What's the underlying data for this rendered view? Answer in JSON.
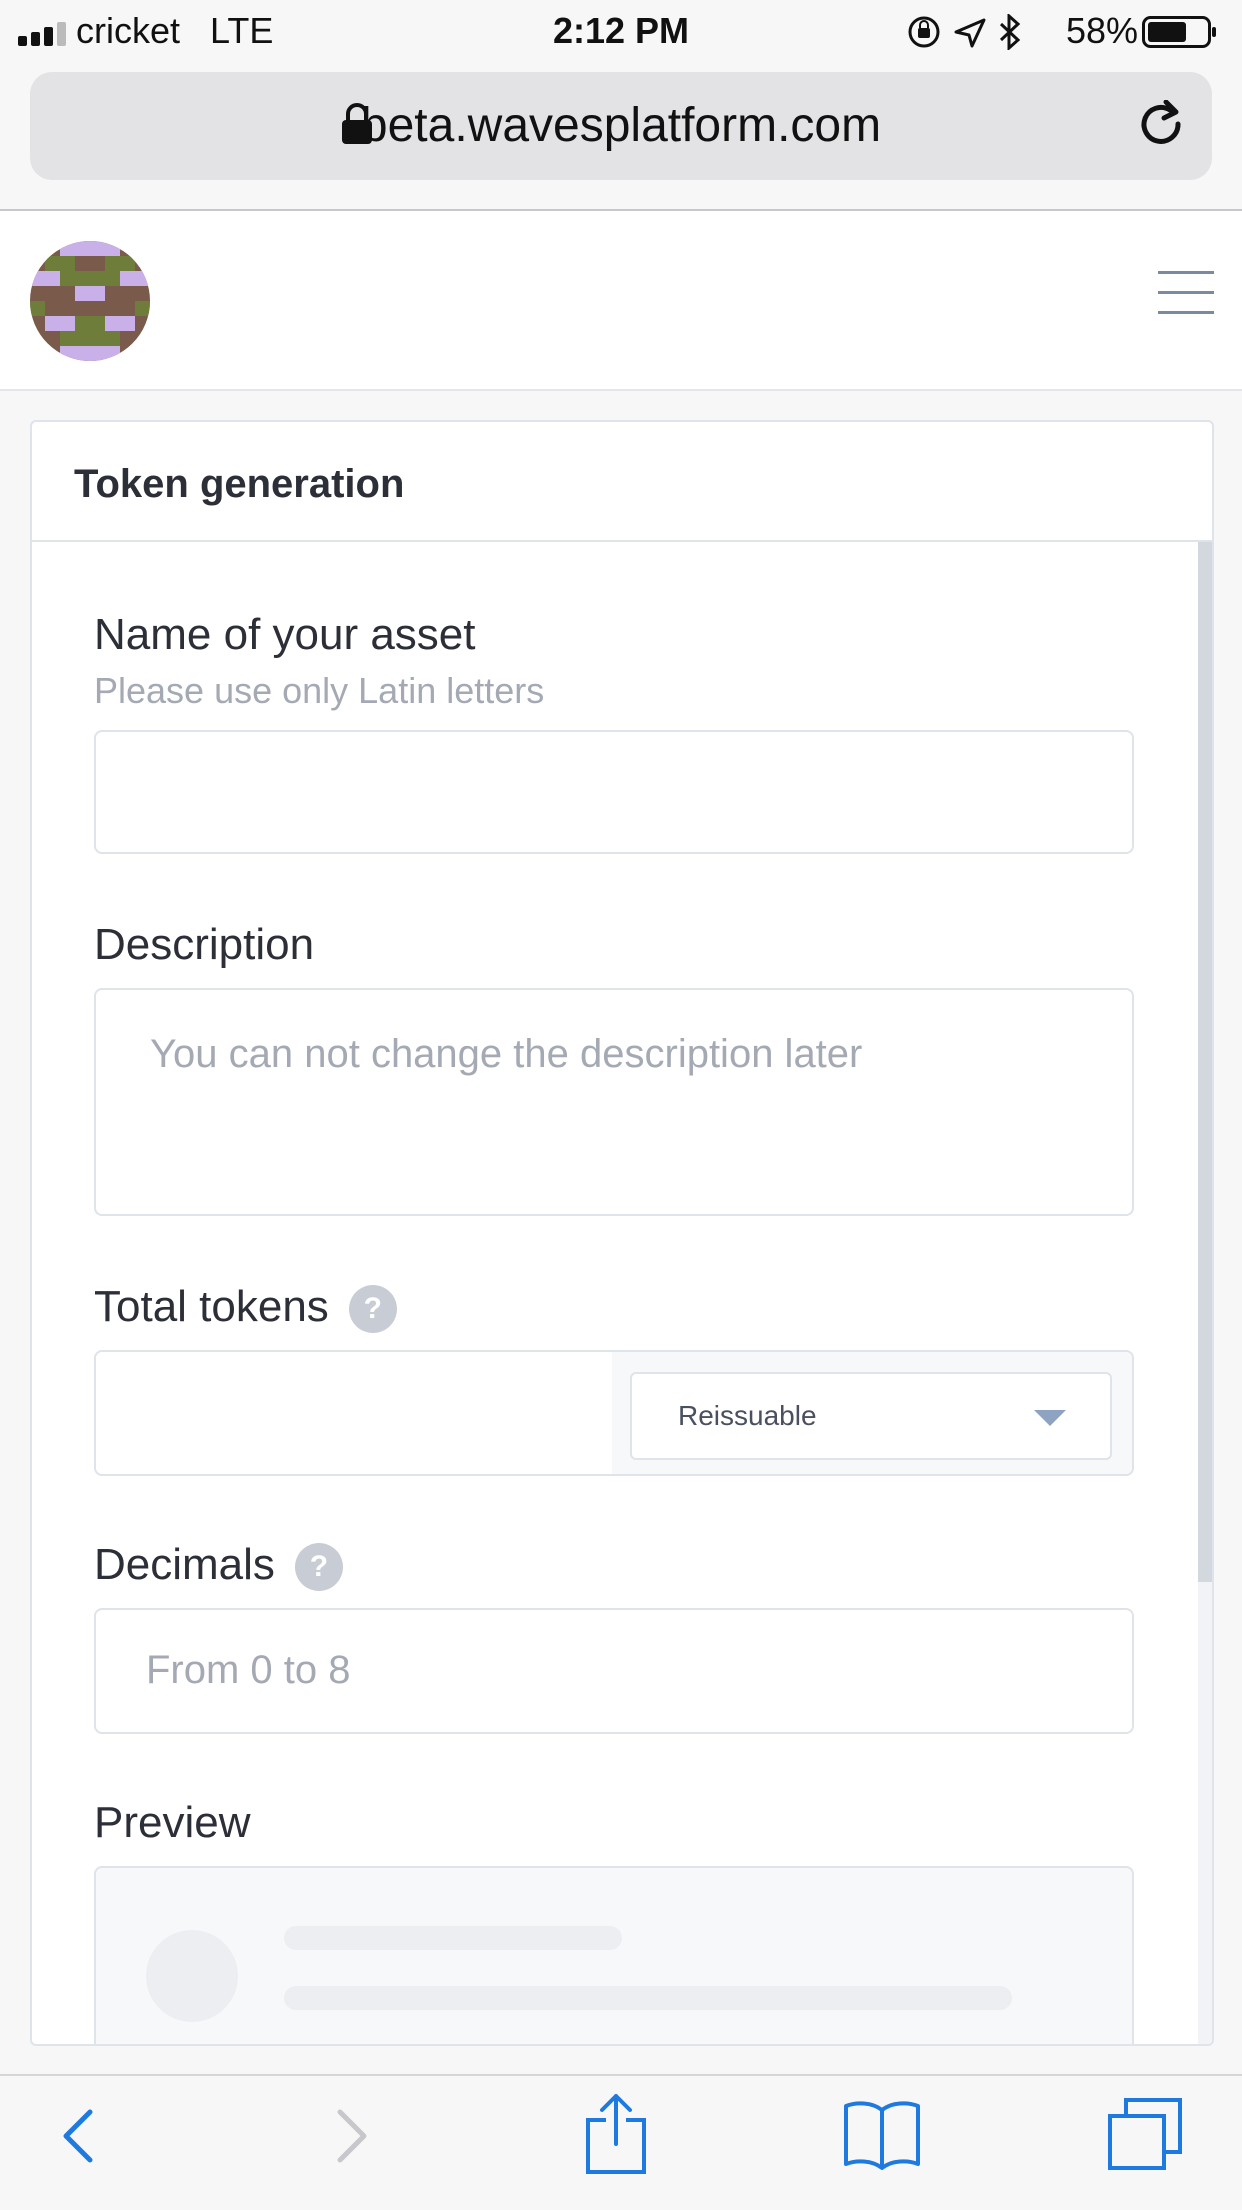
{
  "status_bar": {
    "carrier": "cricket   LTE",
    "time": "2:12 PM",
    "battery_percent": "58%"
  },
  "browser": {
    "url": "beta.wavesplatform.com"
  },
  "card": {
    "title": "Token generation"
  },
  "form": {
    "name_label": "Name of your asset",
    "name_hint": "Please use only Latin letters",
    "name_value": "",
    "description_label": "Description",
    "description_placeholder": "You can not change the description later",
    "total_label": "Total tokens",
    "total_value": "",
    "reissue_select": "Reissuable",
    "decimals_label": "Decimals",
    "decimals_placeholder": "From 0 to 8",
    "preview_label": "Preview",
    "help_glyph": "?"
  },
  "icons": {
    "status": [
      "signal-icon",
      "orientation-lock-icon",
      "location-icon",
      "bluetooth-icon",
      "battery-icon"
    ],
    "browser": [
      "lock-icon",
      "reload-icon"
    ],
    "toolbar": [
      "back-icon",
      "forward-icon",
      "share-icon",
      "bookmarks-icon",
      "tabs-icon"
    ],
    "header": [
      "avatar",
      "menu-icon"
    ]
  },
  "colors": {
    "accent": "#1f7ae0",
    "label": "#2d2f38",
    "muted": "#a4a9b4",
    "border": "#dfe3ea"
  }
}
